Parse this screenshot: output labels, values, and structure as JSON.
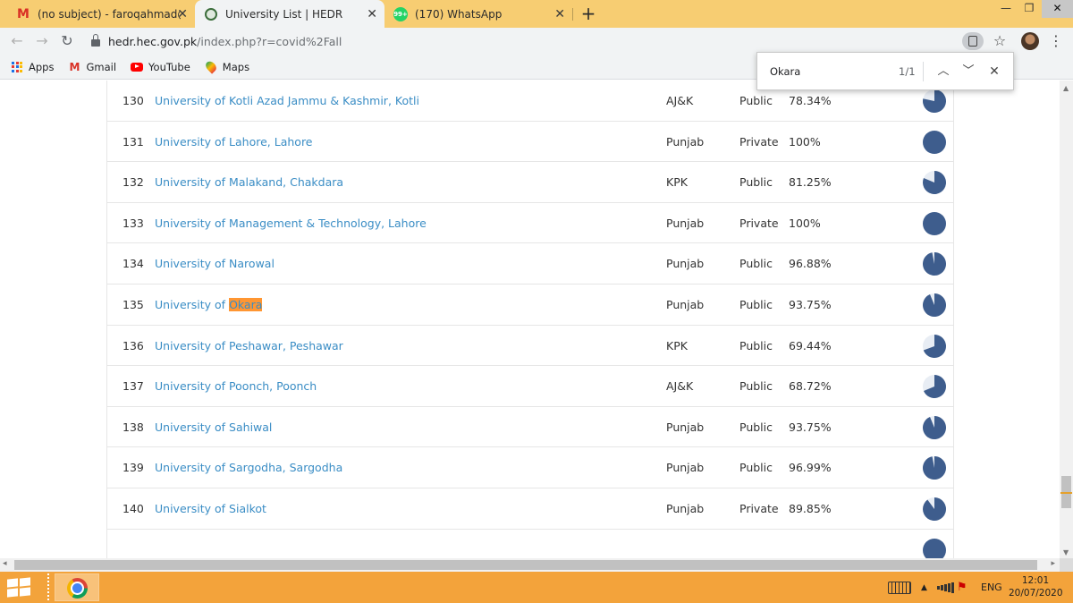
{
  "browser": {
    "tabs": [
      {
        "title": "(no subject) - faroqahmad@gmail.com",
        "active": false,
        "icon": "gmail-icon"
      },
      {
        "title": "University List | HEDR",
        "active": true,
        "icon": "hec-icon"
      },
      {
        "title": "(170) WhatsApp",
        "active": false,
        "icon": "whatsapp-icon"
      }
    ],
    "whatsapp_badge": "99+",
    "url_host": "hedr.hec.gov.pk",
    "url_path": "/index.php?r=covid%2Fall",
    "bookmarks": [
      {
        "label": "Apps",
        "icon": "apps-icon"
      },
      {
        "label": "Gmail",
        "icon": "gmail-icon"
      },
      {
        "label": "YouTube",
        "icon": "youtube-icon"
      },
      {
        "label": "Maps",
        "icon": "maps-icon"
      }
    ]
  },
  "find_bar": {
    "query": "Okara",
    "count": "1/1"
  },
  "table": {
    "rows": [
      {
        "num": "130",
        "name": "University of Kotli Azad Jammu & Kashmir, Kotli",
        "province": "AJ&K",
        "sector": "Public",
        "pct": "78.34%",
        "ratio": 0.7834
      },
      {
        "num": "131",
        "name": "University of Lahore, Lahore",
        "province": "Punjab",
        "sector": "Private",
        "pct": "100%",
        "ratio": 1.0
      },
      {
        "num": "132",
        "name": "University of Malakand, Chakdara",
        "province": "KPK",
        "sector": "Public",
        "pct": "81.25%",
        "ratio": 0.8125
      },
      {
        "num": "133",
        "name": "University of Management & Technology, Lahore",
        "province": "Punjab",
        "sector": "Private",
        "pct": "100%",
        "ratio": 1.0
      },
      {
        "num": "134",
        "name": "University of Narowal",
        "province": "Punjab",
        "sector": "Public",
        "pct": "96.88%",
        "ratio": 0.9688
      },
      {
        "num": "135",
        "name_prefix": "University of ",
        "name_highlight": "Okara",
        "province": "Punjab",
        "sector": "Public",
        "pct": "93.75%",
        "ratio": 0.9375
      },
      {
        "num": "136",
        "name": "University of Peshawar, Peshawar",
        "province": "KPK",
        "sector": "Public",
        "pct": "69.44%",
        "ratio": 0.6944
      },
      {
        "num": "137",
        "name": "University of Poonch, Poonch",
        "province": "AJ&K",
        "sector": "Public",
        "pct": "68.72%",
        "ratio": 0.6872
      },
      {
        "num": "138",
        "name": "University of Sahiwal",
        "province": "Punjab",
        "sector": "Public",
        "pct": "93.75%",
        "ratio": 0.9375
      },
      {
        "num": "139",
        "name": "University of Sargodha, Sargodha",
        "province": "Punjab",
        "sector": "Public",
        "pct": "96.99%",
        "ratio": 0.9699
      },
      {
        "num": "140",
        "name": "University of Sialkot",
        "province": "Punjab",
        "sector": "Private",
        "pct": "89.85%",
        "ratio": 0.8985
      }
    ],
    "pie_fill_color": "#3e5d8d",
    "pie_bg_color": "#e8edf4"
  },
  "taskbar": {
    "language": "ENG",
    "time": "12:01",
    "date": "20/07/2020"
  }
}
